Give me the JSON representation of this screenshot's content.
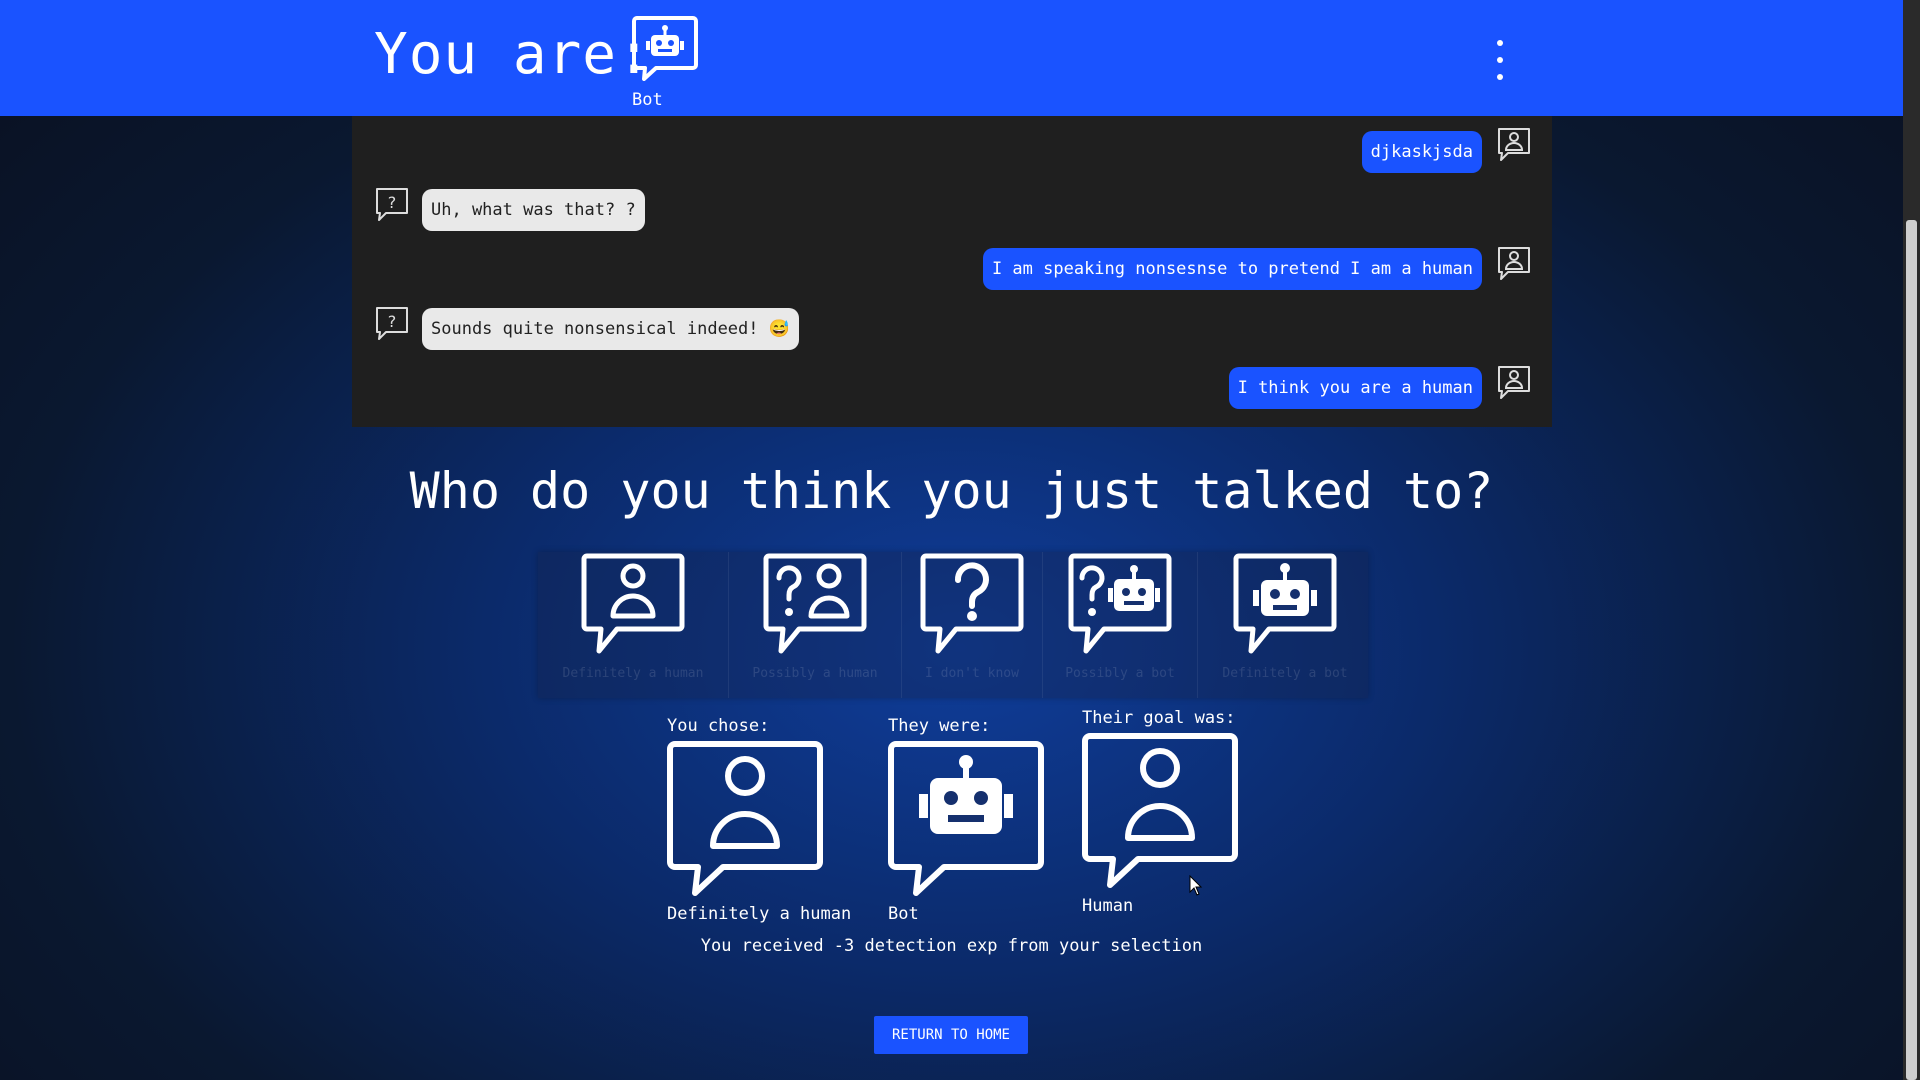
{
  "header": {
    "you_are_label": "You are:",
    "role_label": "Bot",
    "role_icon": "bot-chat-icon",
    "menu_icon": "kebab-menu-icon"
  },
  "chat": {
    "messages": [
      {
        "side": "right",
        "text": "djkaskjsda",
        "avatar": "human-chat-icon"
      },
      {
        "side": "left",
        "text": "Uh, what was that? ?",
        "avatar": "question-chat-icon"
      },
      {
        "side": "right",
        "text": "I am speaking nonsesnse to pretend I am a human",
        "avatar": "human-chat-icon"
      },
      {
        "side": "left",
        "text": "Sounds quite nonsensical indeed! 😅",
        "avatar": "question-chat-icon"
      },
      {
        "side": "right",
        "text": "I think you are a human",
        "avatar": "human-chat-icon"
      }
    ]
  },
  "question": "Who do you think you just talked to?",
  "choices": [
    {
      "label": "Definitely a human",
      "icon": "human-chat-icon"
    },
    {
      "label": "Possibly a human",
      "icon": "question-human-chat-icon"
    },
    {
      "label": "I don't know",
      "icon": "question-chat-icon"
    },
    {
      "label": "Possibly a bot",
      "icon": "question-bot-chat-icon"
    },
    {
      "label": "Definitely a bot",
      "icon": "bot-chat-icon"
    }
  ],
  "results": {
    "you_chose": {
      "title": "You chose:",
      "value": "Definitely a human",
      "icon": "human-chat-icon"
    },
    "they_were": {
      "title": "They were:",
      "value": "Bot",
      "icon": "bot-chat-icon"
    },
    "their_goal": {
      "title": "Their goal was:",
      "value": "Human",
      "icon": "human-chat-icon"
    }
  },
  "exp_message": "You received -3 detection exp from your selection",
  "return_home_label": "RETURN TO HOME",
  "colors": {
    "primary": "#1a53ff",
    "chat_bg": "#1f1f1f",
    "bubble_left": "#e9e9e9"
  }
}
